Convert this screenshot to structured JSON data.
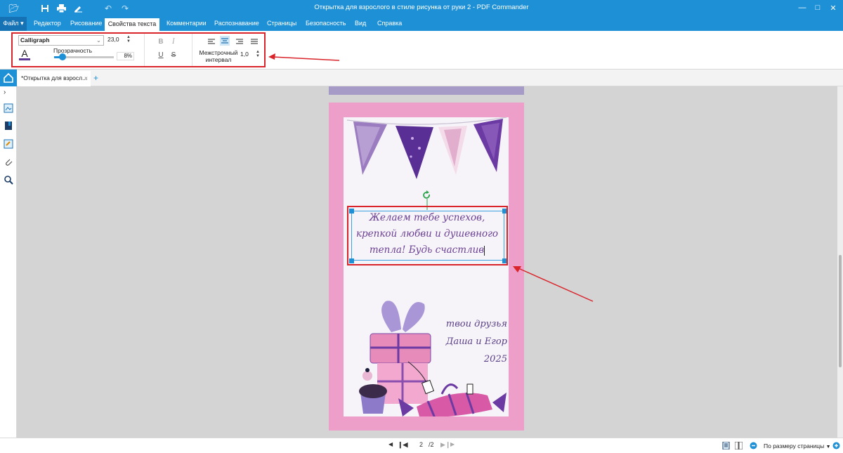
{
  "window": {
    "title": "Открытка для взрослого в стиле рисунка от руки 2 - PDF Commander"
  },
  "ribbon": {
    "tabs": [
      {
        "label": "Файл"
      },
      {
        "label": "Редактор"
      },
      {
        "label": "Рисование"
      },
      {
        "label": "Свойства текста"
      },
      {
        "label": "Комментарии"
      },
      {
        "label": "Распознавание"
      },
      {
        "label": "Страницы"
      },
      {
        "label": "Безопасность"
      },
      {
        "label": "Вид"
      },
      {
        "label": "Справка"
      }
    ],
    "active_tab": "Свойства текста"
  },
  "text_props": {
    "font": "Calligraph",
    "font_size": "23,0",
    "transparency_label": "Прозрачность",
    "transparency_value": "8%",
    "transparency": 0.08,
    "line_spacing_label_1": "Межстрочный",
    "line_spacing_label_2": "интервал",
    "line_spacing_value": "1,0",
    "color_swatch": "#5e3a96",
    "accent": "#1e90d6",
    "highlight": "#d9242b"
  },
  "document_tab": {
    "label": "*Открытка для взросл...",
    "close": "×",
    "add": "+"
  },
  "card": {
    "greeting_lines": [
      "Желаем тебе успехов,",
      "крепкой любви и душевного",
      "тепла! Будь счастлив"
    ],
    "signature_lines": [
      "твои друзья",
      "Даша и Егор",
      "2025"
    ],
    "page_color": "#ee9fc9",
    "ink_color": "#6a3f93"
  },
  "status": {
    "current_page": "2",
    "total_pages": "/2",
    "zoom_label": "По размеру страницы"
  }
}
